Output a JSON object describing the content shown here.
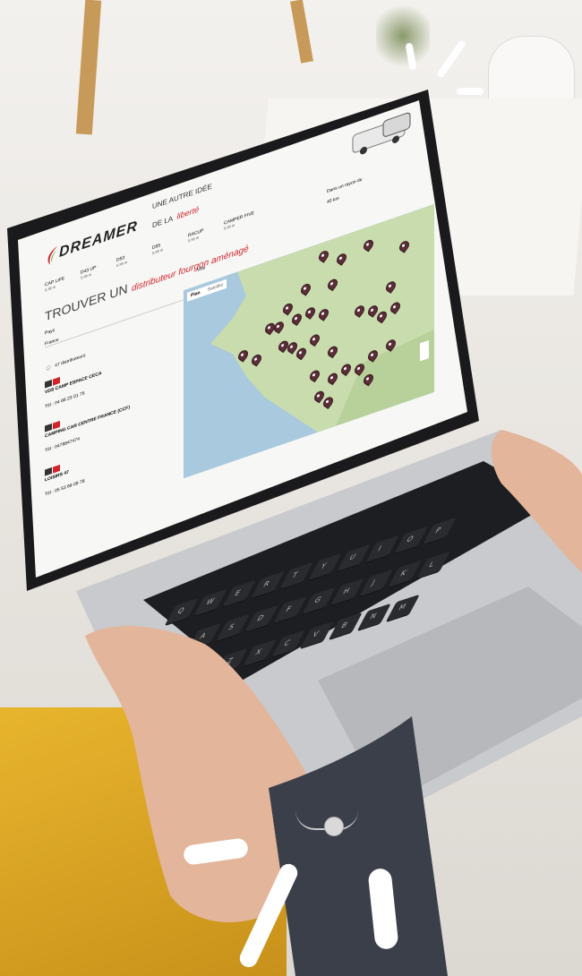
{
  "site": {
    "brand": "DREAMER",
    "tagline_line1": "UNE AUTRE IDÉE",
    "tagline_line2": "DE LA",
    "tagline_script": "liberté",
    "nav_items": [
      {
        "name": "CAP LIFE",
        "sub": "5,36 m"
      },
      {
        "name": "D43 UP",
        "sub": "5,99 m"
      },
      {
        "name": "D53",
        "sub": "5,99 m"
      },
      {
        "name": "D55",
        "sub": "5,99 m"
      },
      {
        "name": "RACUP",
        "sub": "5,99 m"
      },
      {
        "name": "CAMPER FIVE",
        "sub": "5,99 m"
      }
    ]
  },
  "page": {
    "title_prefix": "TROUVER UN",
    "title_script": "distributeur fourgon aménagé",
    "country_label": "Pays",
    "country_value": "France",
    "city_label": "Ville",
    "radius_label": "Dans un rayon de",
    "radius_value": "40 km",
    "results_count": "47 distributeurs",
    "map_tabs": [
      "Plan",
      "Satellite"
    ],
    "dealers": [
      {
        "name": "VDS CAMP ESPACE CECA",
        "tel": "Tél : 04 66 23 01 75"
      },
      {
        "name": "CAMPING CAR CENTRE FRANCE (CCF)",
        "tel": "Tél : 0476847474"
      },
      {
        "name": "LOISIRS 47",
        "tel": "Tél : 05 53 69 09 78"
      }
    ]
  },
  "colors": {
    "accent": "#d2232a",
    "pin": "#5b2e38",
    "sea": "#a9c9de",
    "land": "#c9dcae"
  }
}
